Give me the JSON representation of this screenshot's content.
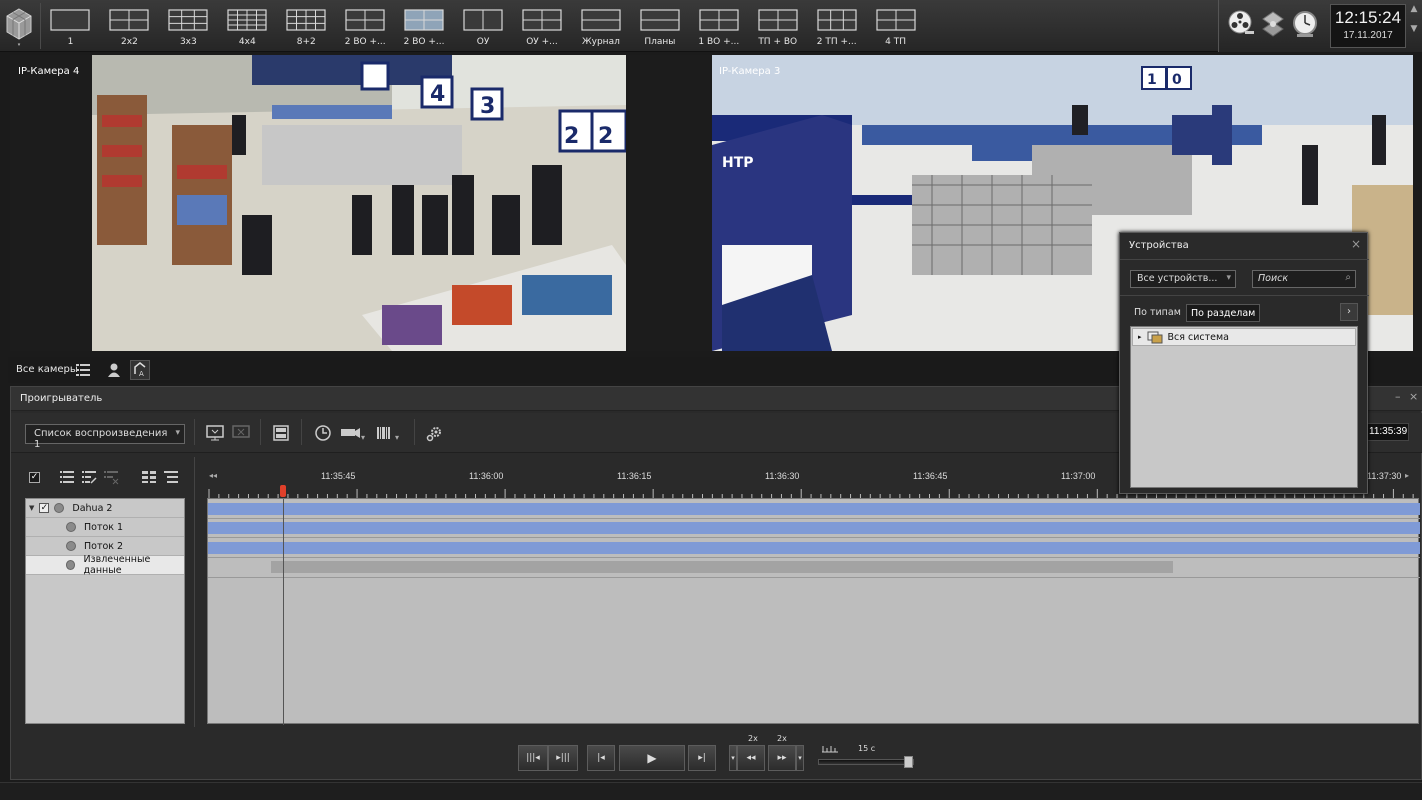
{
  "toolbar": {
    "layouts": [
      {
        "label": "1",
        "cols": 1,
        "rows": 1
      },
      {
        "label": "2x2",
        "cols": 2,
        "rows": 2
      },
      {
        "label": "3x3",
        "cols": 3,
        "rows": 3
      },
      {
        "label": "4x4",
        "cols": 4,
        "rows": 4
      },
      {
        "label": "8+2",
        "cols": 4,
        "rows": 3
      },
      {
        "label": "2 ВО +...",
        "cols": 2,
        "rows": 2
      },
      {
        "label": "2 ВО +...",
        "cols": 2,
        "rows": 2,
        "selected": true
      },
      {
        "label": "ОУ",
        "cols": 2,
        "rows": 1
      },
      {
        "label": "ОУ +...",
        "cols": 2,
        "rows": 2
      },
      {
        "label": "Журнал",
        "cols": 1,
        "rows": 2
      },
      {
        "label": "Планы",
        "cols": 1,
        "rows": 2
      },
      {
        "label": "1 ВО +...",
        "cols": 2,
        "rows": 2
      },
      {
        "label": "ТП + ВО",
        "cols": 2,
        "rows": 2
      },
      {
        "label": "2 ТП +...",
        "cols": 3,
        "rows": 2
      },
      {
        "label": "4 ТП",
        "cols": 2,
        "rows": 2
      }
    ],
    "icons": [
      "film-reel-icon",
      "network-icon",
      "clock-icon"
    ]
  },
  "clock": {
    "time": "12:15:24",
    "date": "17.11.2017"
  },
  "cameras": {
    "left": {
      "label": "IP-Камера 4"
    },
    "right": {
      "label": "IP-Камера 3"
    }
  },
  "camera_bar": {
    "label": "Все камеры"
  },
  "player": {
    "title": "Проигрыватель",
    "playlist": "Список воспроизведения 1",
    "time_display": "11:35:39",
    "tree": [
      {
        "label": "Dahua 2",
        "level": 0,
        "checked": true
      },
      {
        "label": "Поток 1",
        "level": 1
      },
      {
        "label": "Поток 2",
        "level": 1
      },
      {
        "label": "Извлеченные данные",
        "level": 1,
        "highlight": true
      }
    ],
    "timeline": {
      "ticks": [
        "11:35:45",
        "11:36:00",
        "11:36:15",
        "11:36:30",
        "11:36:45",
        "11:37:00",
        "11:37:30"
      ]
    },
    "transport": {
      "speed_back": "2x",
      "speed_fwd": "2x",
      "interval": "15 с"
    }
  },
  "devices": {
    "title": "Устройства",
    "filter": "Все устройств...",
    "search_placeholder": "Поиск",
    "tabs": [
      "По типам",
      "По разделам"
    ],
    "root": "Вся система"
  }
}
